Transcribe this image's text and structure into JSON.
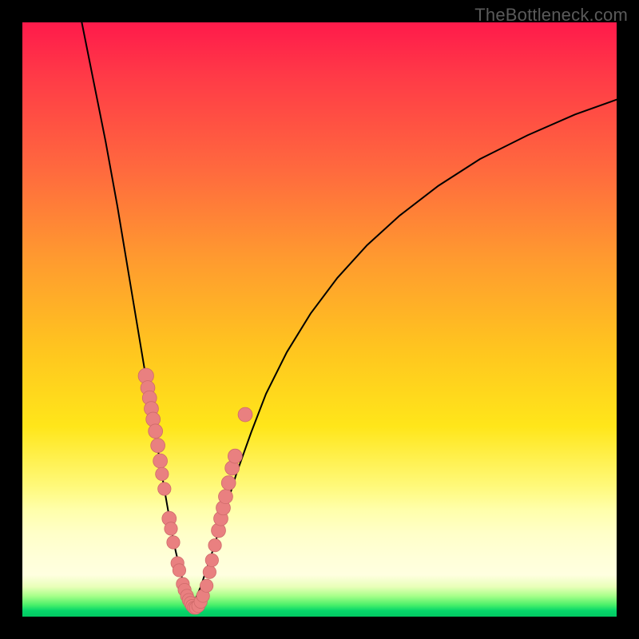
{
  "watermark": "TheBottleneck.com",
  "chart_data": {
    "type": "line",
    "title": "",
    "xlabel": "",
    "ylabel": "",
    "xlim": [
      0,
      100
    ],
    "ylim": [
      0,
      100
    ],
    "curve_left": {
      "name": "left-branch",
      "x": [
        10.0,
        12.0,
        14.0,
        16.0,
        18.0,
        20.0,
        21.0,
        22.0,
        23.0,
        23.8,
        24.5,
        25.2,
        25.8,
        26.4,
        27.0,
        27.8,
        28.5
      ],
      "y": [
        100.0,
        90.0,
        80.0,
        69.0,
        57.0,
        45.0,
        39.0,
        33.0,
        27.0,
        22.0,
        18.0,
        14.0,
        11.0,
        8.5,
        6.0,
        3.5,
        1.5
      ]
    },
    "curve_right": {
      "name": "right-branch",
      "x": [
        28.5,
        30.0,
        32.0,
        34.0,
        36.0,
        38.5,
        41.0,
        44.5,
        48.5,
        53.0,
        58.0,
        63.5,
        70.0,
        77.0,
        85.0,
        93.0,
        100.0
      ],
      "y": [
        1.5,
        5.0,
        11.0,
        17.5,
        24.0,
        31.0,
        37.5,
        44.5,
        51.0,
        57.0,
        62.5,
        67.5,
        72.5,
        77.0,
        81.0,
        84.5,
        87.0
      ]
    },
    "scatter": {
      "name": "dots",
      "points": [
        {
          "x": 20.8,
          "y": 40.5,
          "r": 1.3
        },
        {
          "x": 21.1,
          "y": 38.5,
          "r": 1.2
        },
        {
          "x": 21.4,
          "y": 36.8,
          "r": 1.2
        },
        {
          "x": 21.7,
          "y": 35.0,
          "r": 1.2
        },
        {
          "x": 22.0,
          "y": 33.2,
          "r": 1.2
        },
        {
          "x": 22.4,
          "y": 31.2,
          "r": 1.2
        },
        {
          "x": 22.8,
          "y": 28.8,
          "r": 1.2
        },
        {
          "x": 23.2,
          "y": 26.2,
          "r": 1.2
        },
        {
          "x": 23.5,
          "y": 24.0,
          "r": 1.1
        },
        {
          "x": 23.9,
          "y": 21.5,
          "r": 1.1
        },
        {
          "x": 24.7,
          "y": 16.5,
          "r": 1.2
        },
        {
          "x": 25.0,
          "y": 14.8,
          "r": 1.1
        },
        {
          "x": 25.4,
          "y": 12.5,
          "r": 1.1
        },
        {
          "x": 26.1,
          "y": 9.0,
          "r": 1.1
        },
        {
          "x": 26.4,
          "y": 7.8,
          "r": 1.1
        },
        {
          "x": 27.0,
          "y": 5.5,
          "r": 1.1
        },
        {
          "x": 27.3,
          "y": 4.5,
          "r": 1.1
        },
        {
          "x": 27.7,
          "y": 3.5,
          "r": 1.1
        },
        {
          "x": 28.0,
          "y": 2.8,
          "r": 1.1
        },
        {
          "x": 28.3,
          "y": 2.3,
          "r": 1.1
        },
        {
          "x": 28.6,
          "y": 1.8,
          "r": 1.1
        },
        {
          "x": 28.9,
          "y": 1.5,
          "r": 1.1
        },
        {
          "x": 29.2,
          "y": 1.5,
          "r": 1.1
        },
        {
          "x": 29.6,
          "y": 1.8,
          "r": 1.1
        },
        {
          "x": 30.0,
          "y": 2.5,
          "r": 1.1
        },
        {
          "x": 30.4,
          "y": 3.5,
          "r": 1.1
        },
        {
          "x": 31.0,
          "y": 5.2,
          "r": 1.1
        },
        {
          "x": 31.5,
          "y": 7.5,
          "r": 1.1
        },
        {
          "x": 31.9,
          "y": 9.5,
          "r": 1.1
        },
        {
          "x": 32.4,
          "y": 12.0,
          "r": 1.1
        },
        {
          "x": 33.0,
          "y": 14.5,
          "r": 1.2
        },
        {
          "x": 33.4,
          "y": 16.5,
          "r": 1.2
        },
        {
          "x": 33.8,
          "y": 18.3,
          "r": 1.2
        },
        {
          "x": 34.2,
          "y": 20.2,
          "r": 1.2
        },
        {
          "x": 34.7,
          "y": 22.5,
          "r": 1.2
        },
        {
          "x": 35.3,
          "y": 25.0,
          "r": 1.2
        },
        {
          "x": 35.8,
          "y": 27.0,
          "r": 1.2
        },
        {
          "x": 37.5,
          "y": 34.0,
          "r": 1.2
        }
      ]
    },
    "colors": {
      "curve": "#000000",
      "dot_fill": "#e98080",
      "dot_stroke": "#cf6a6a"
    }
  }
}
